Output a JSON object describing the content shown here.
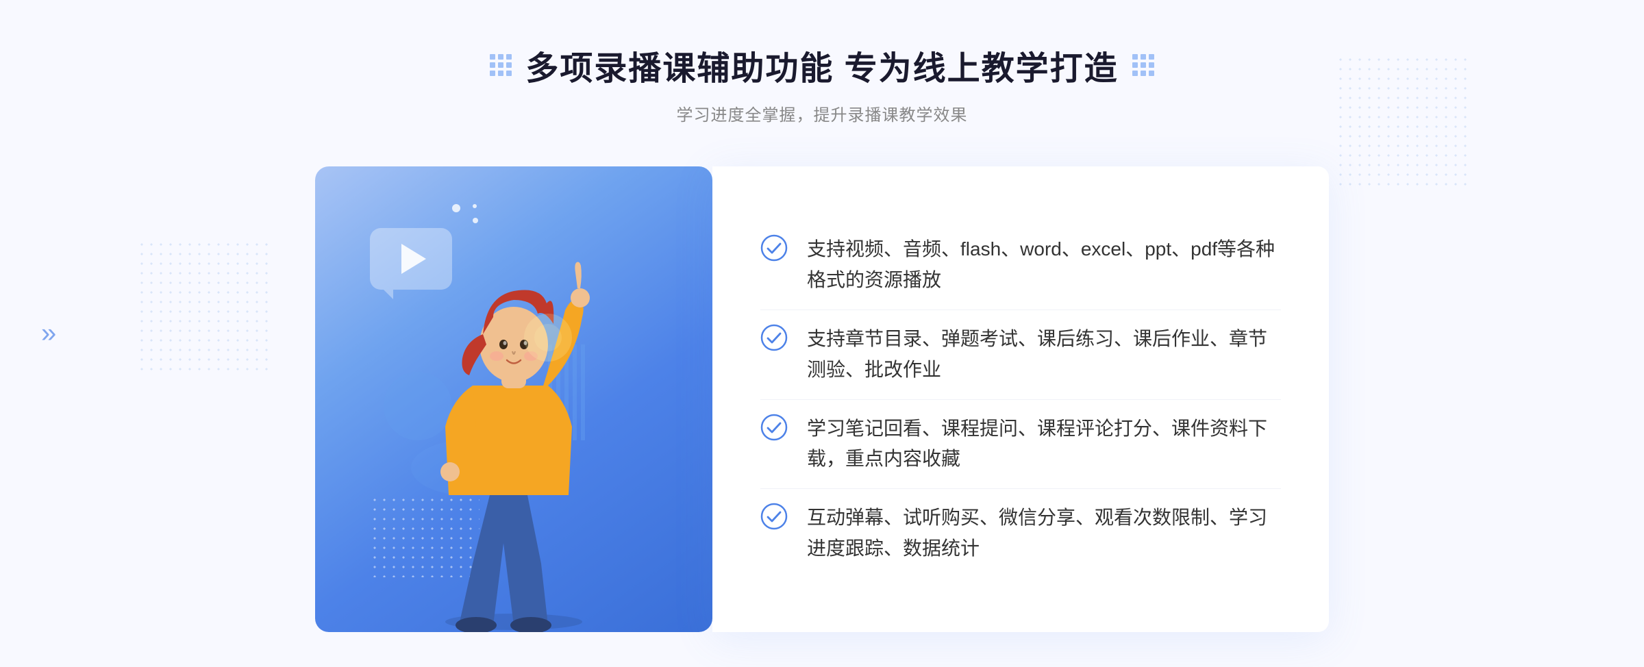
{
  "header": {
    "title": "多项录播课辅助功能 专为线上教学打造",
    "subtitle": "学习进度全掌握，提升录播课教学效果"
  },
  "features": [
    {
      "id": 1,
      "text": "支持视频、音频、flash、word、excel、ppt、pdf等各种格式的资源播放"
    },
    {
      "id": 2,
      "text": "支持章节目录、弹题考试、课后练习、课后作业、章节测验、批改作业"
    },
    {
      "id": 3,
      "text": "学习笔记回看、课程提问、课程评论打分、课件资料下载，重点内容收藏"
    },
    {
      "id": 4,
      "text": "互动弹幕、试听购买、微信分享、观看次数限制、学习进度跟踪、数据统计"
    }
  ],
  "colors": {
    "accent": "#4d82e8",
    "text_primary": "#1a1a2e",
    "text_secondary": "#888888",
    "text_feature": "#333333"
  },
  "icons": {
    "grid_icon": "⠿",
    "check_icon": "check-circle",
    "arrow_left": "»",
    "play": "▶"
  }
}
